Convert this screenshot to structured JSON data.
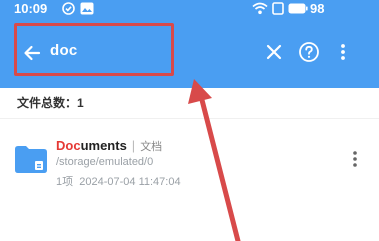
{
  "status_bar": {
    "time": "10:09",
    "battery": "98"
  },
  "toolbar": {
    "search_query": "doc",
    "icons": [
      "back-arrow-icon",
      "close-icon",
      "help-icon",
      "more-vert-icon"
    ]
  },
  "results": {
    "count_label": "文件总数：1",
    "items": [
      {
        "name_match": "Doc",
        "name_rest": "uments",
        "tag": "文档",
        "path": "/storage/emulated/0",
        "count": "1项",
        "modified": "2024-07-04 11:47:04"
      }
    ]
  },
  "colors": {
    "toolbar_bg": "#4a9ef2",
    "highlight": "#e53935",
    "annotation": "#d84a4a"
  }
}
